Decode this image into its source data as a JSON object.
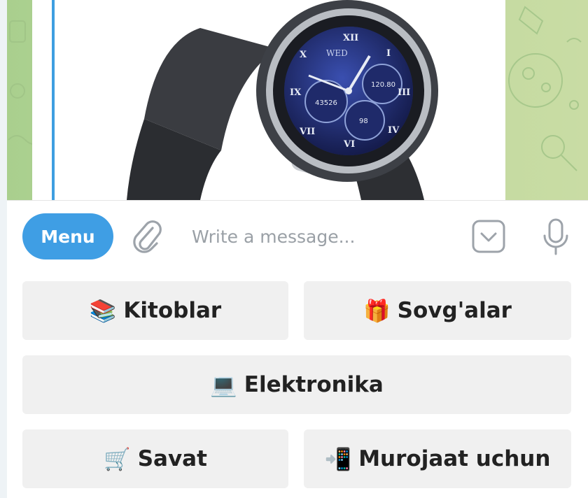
{
  "composer": {
    "menu_label": "Menu",
    "message_placeholder": "Write a message..."
  },
  "keyboard": {
    "rows": [
      [
        {
          "emoji": "📚",
          "label": "Kitoblar"
        },
        {
          "emoji": "🎁",
          "label": "Sovg'alar"
        }
      ],
      [
        {
          "emoji": "💻",
          "label": "Elektronika"
        }
      ],
      [
        {
          "emoji": "🛒",
          "label": "Savat"
        },
        {
          "emoji": "📲",
          "label": "Murojaat uchun"
        }
      ]
    ]
  },
  "message": {
    "image": {
      "watch_brand": "WED",
      "subdial_left": "43526",
      "subdial_top": "120.80",
      "subdial_bottom": "98"
    }
  },
  "colors": {
    "accent": "#3f9ee4",
    "button_bg": "#f0f0f0",
    "chat_bg": "#bcd89b",
    "reply_bar": "#3e9ee0"
  },
  "icons": {
    "attach": "paperclip-icon",
    "keyboard": "keyboard-toggle-icon",
    "voice": "microphone-icon"
  }
}
